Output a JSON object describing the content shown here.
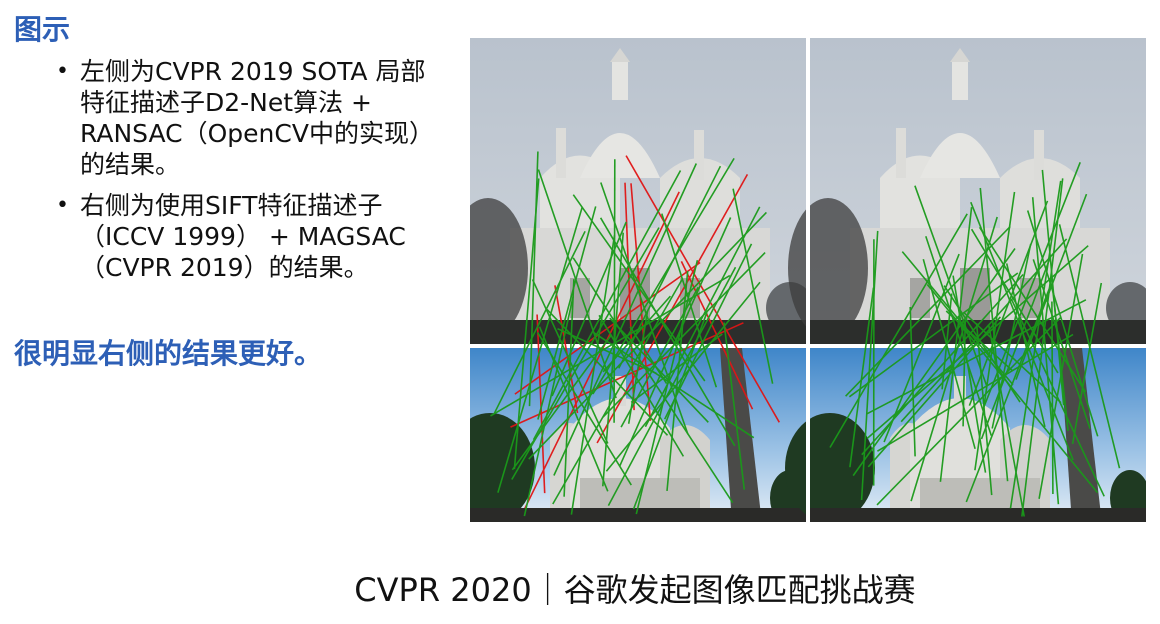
{
  "heading": "图示",
  "bullets": [
    "左侧为CVPR 2019 SOTA 局部特征描述子D2-Net算法 + RANSAC（OpenCV中的实现）的结果。",
    "右侧为使用SIFT特征描述子（ICCV 1999） + MAGSAC（CVPR 2019）的结果。"
  ],
  "conclusion": "很明显右侧的结果更好。",
  "footer": "CVPR 2020｜谷歌发起图像匹配挑战赛",
  "colors": {
    "accent_blue": "#2d5fb6",
    "inlier_green": "#1a9a1a",
    "outlier_red": "#e01515"
  }
}
